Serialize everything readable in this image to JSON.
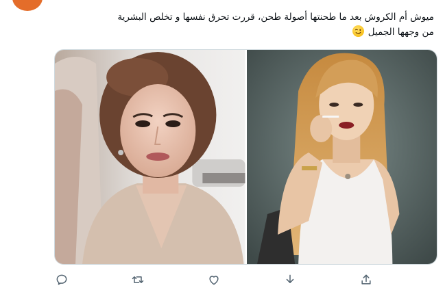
{
  "tweet": {
    "text_line1": "ميوش أم الكروش بعد ما طحنتها أصولة طحن،  قررت تحرق نفسها و تخلص البشرية",
    "text_line2": "من وجهها الجميل",
    "emoji": "winking-face-emoji"
  },
  "media": {
    "photos": [
      {
        "alt": "photo-left-woman-in-beige-blouse"
      },
      {
        "alt": "photo-right-blonde-woman-in-white-top"
      }
    ]
  },
  "actions": {
    "icons": [
      "reply-icon",
      "retweet-icon",
      "like-icon",
      "download-icon",
      "share-icon"
    ]
  },
  "colors": {
    "text": "#0f1419",
    "icon": "#536471",
    "border": "#cfd9de",
    "avatar": "#e46d2a"
  }
}
